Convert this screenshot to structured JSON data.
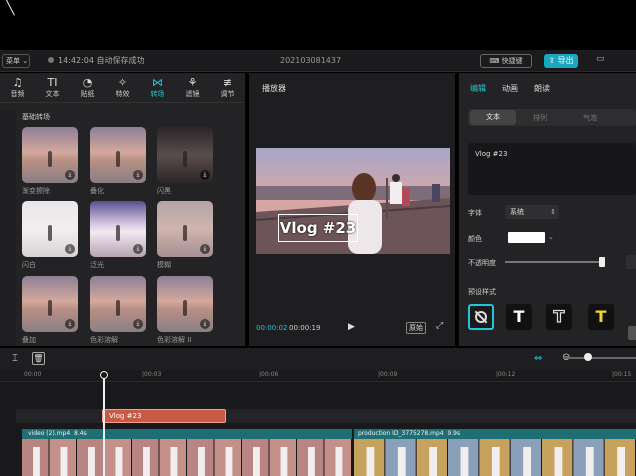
{
  "top": {
    "menu": "菜单",
    "time": "14:42:04",
    "status": "自动保存成功",
    "project": "202103081437",
    "shortcut": "快捷键",
    "export": "导出"
  },
  "toolbar": {
    "items": [
      {
        "icon": "music-icon",
        "glyph": "♫",
        "label": "音频"
      },
      {
        "icon": "text-icon",
        "glyph": "TI",
        "label": "文本"
      },
      {
        "icon": "sticker-icon",
        "glyph": "◔",
        "label": "贴纸"
      },
      {
        "icon": "effects-icon",
        "glyph": "✧",
        "label": "特效"
      },
      {
        "icon": "transition-icon",
        "glyph": "⋈",
        "label": "转场"
      },
      {
        "icon": "filter-icon",
        "glyph": "⚘",
        "label": "滤镜"
      },
      {
        "icon": "adjust-icon",
        "glyph": "≢",
        "label": "调节"
      }
    ]
  },
  "media": {
    "section": "基础转场",
    "cards": [
      {
        "label": "渐变擦除",
        "style": "dusk"
      },
      {
        "label": "叠化",
        "style": "dusk"
      },
      {
        "label": "闪黑",
        "style": "dark"
      },
      {
        "label": "闪白",
        "style": "white"
      },
      {
        "label": "泛光",
        "style": "violet"
      },
      {
        "label": "模糊",
        "style": "blur"
      },
      {
        "label": "叠加",
        "style": "dusk"
      },
      {
        "label": "色彩溶解",
        "style": "dusk"
      },
      {
        "label": "色彩溶解 II",
        "style": "dusk"
      }
    ]
  },
  "player": {
    "title": "播放器",
    "overlay": "Vlog #23",
    "current": "00:00:02",
    "total": "00:00:19",
    "ratio": "原始"
  },
  "inspector": {
    "tabs": [
      "编辑",
      "动画",
      "朗读"
    ],
    "subtabs": [
      "文本",
      "排列",
      "气泡"
    ],
    "text_value": "Vlog #23",
    "font_label": "字体",
    "font_value": "系统",
    "color_label": "颜色",
    "opacity_label": "不透明度",
    "preset_label": "预设样式",
    "opacity": 1
  },
  "timeline": {
    "ticks": [
      "00:00",
      "|00:03",
      "|00:06",
      "|00:09",
      "|00:12",
      "|00:15"
    ],
    "text_clip": "Vlog #23",
    "clip1_name": "video (2).mp4",
    "clip1_dur": "8.4s",
    "clip2_name": "production ID_3775278.mp4",
    "clip2_dur": "9.9s"
  },
  "colors": {
    "accent": "#21c6d8",
    "text_clip": "#c85a45",
    "track": "#1f6e74"
  }
}
